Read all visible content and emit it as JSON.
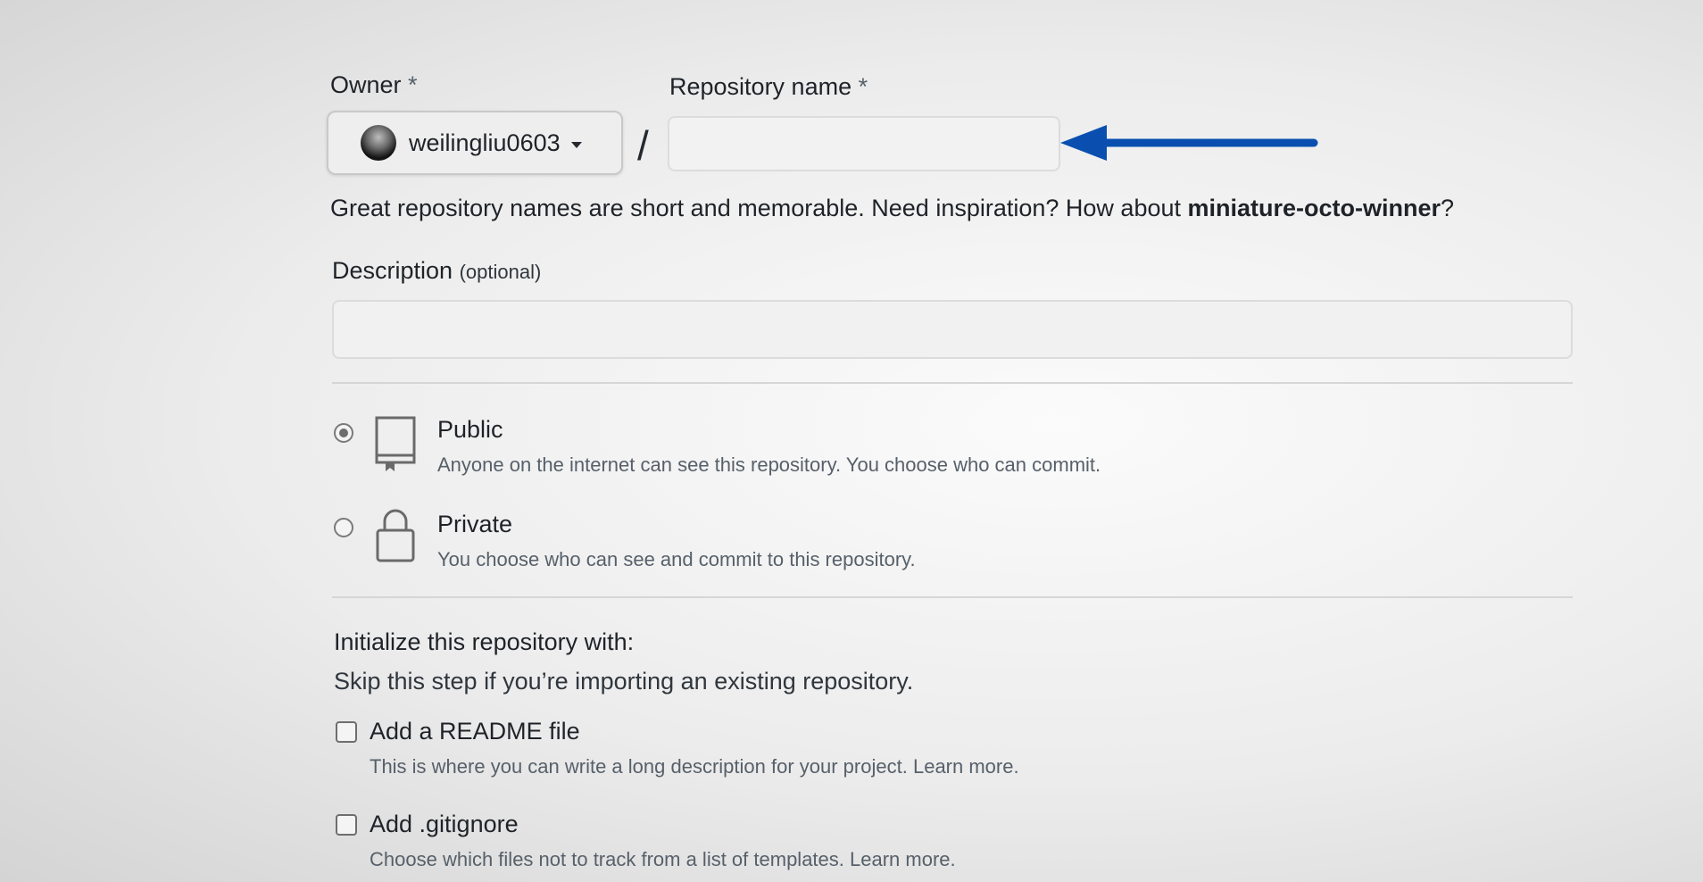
{
  "owner": {
    "label": "Owner",
    "required_mark": "*",
    "selected": "weilingliu0603"
  },
  "repository": {
    "label": "Repository name",
    "required_mark": "*",
    "value": ""
  },
  "hint": {
    "text": "Great repository names are short and memorable. Need inspiration? How about ",
    "suggestion": "miniature-octo-winner",
    "suffix": "?"
  },
  "description": {
    "label": "Description",
    "optional": "(optional)",
    "value": ""
  },
  "visibility": {
    "selected": "public",
    "public": {
      "title": "Public",
      "desc": "Anyone on the internet can see this repository. You choose who can commit."
    },
    "private": {
      "title": "Private",
      "desc": "You choose who can see and commit to this repository."
    }
  },
  "initialize": {
    "title": "Initialize this repository with:",
    "subtitle": "Skip this step if you’re importing an existing repository.",
    "readme": {
      "title": "Add a README file",
      "desc": "This is where you can write a long description for your project.",
      "link": "Learn more."
    },
    "gitignore": {
      "title": "Add .gitignore",
      "desc": "Choose which files not to track from a list of templates.",
      "link": "Learn more."
    }
  },
  "colors": {
    "arrow": "#0a4fb0"
  }
}
